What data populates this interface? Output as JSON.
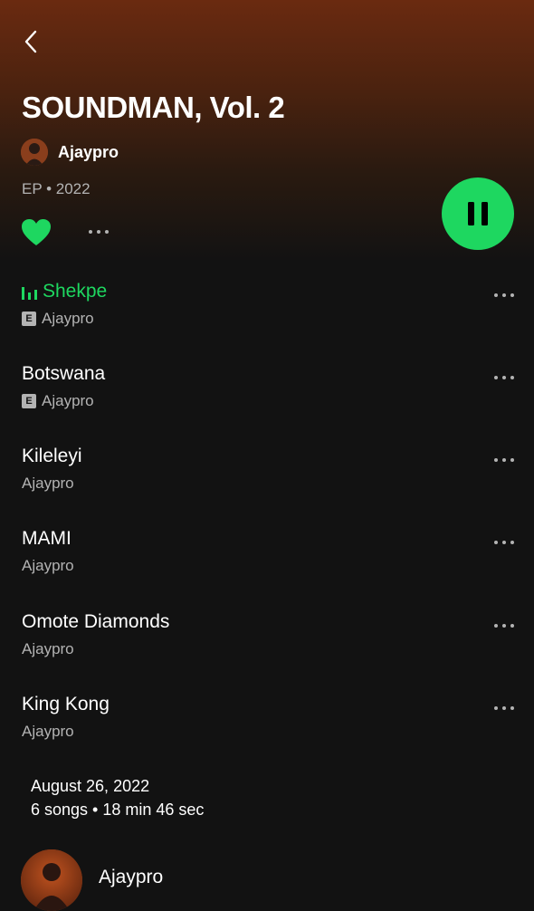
{
  "album": {
    "title": "SOUNDMAN, Vol. 2",
    "artist": "Ajaypro",
    "meta": "EP • 2022",
    "liked": true
  },
  "tracks": [
    {
      "title": "Shekpe",
      "artist": "Ajaypro",
      "explicit": true,
      "playing": true
    },
    {
      "title": "Botswana",
      "artist": "Ajaypro",
      "explicit": true,
      "playing": false
    },
    {
      "title": "Kileleyi",
      "artist": "Ajaypro",
      "explicit": false,
      "playing": false
    },
    {
      "title": "MAMI",
      "artist": "Ajaypro",
      "explicit": false,
      "playing": false
    },
    {
      "title": "Omote Diamonds",
      "artist": "Ajaypro",
      "explicit": false,
      "playing": false
    },
    {
      "title": "King Kong",
      "artist": "Ajaypro",
      "explicit": false,
      "playing": false
    }
  ],
  "explicit_label": "E",
  "release": {
    "date": "August 26, 2022",
    "info": "6 songs • 18 min 46 sec"
  },
  "footer_artist": {
    "name": "Ajaypro"
  },
  "icons": {
    "back": "chevron-left-icon",
    "like": "heart-icon",
    "more": "more-horizontal-icon",
    "play_state": "pause-icon",
    "now_playing": "equalizer-icon"
  },
  "colors": {
    "accent": "#1ed760",
    "background": "#121212",
    "hero": "#6a2a10",
    "subtext": "#b3b3b3"
  }
}
